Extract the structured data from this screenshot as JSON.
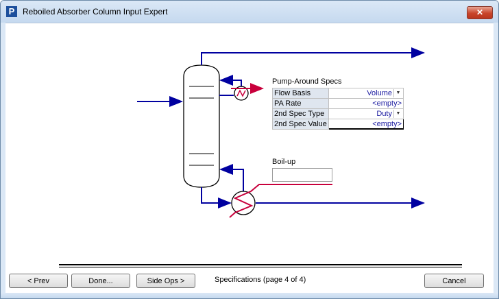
{
  "window": {
    "title": "Reboiled Absorber Column Input Expert",
    "icon_letter": "P",
    "close_glyph": "✕"
  },
  "pump_around": {
    "heading": "Pump-Around Specs",
    "rows": [
      {
        "key": "Flow Basis",
        "value": "Volume",
        "dropdown": true
      },
      {
        "key": "PA Rate",
        "value": "<empty>",
        "dropdown": false
      },
      {
        "key": "2nd Spec Type",
        "value": "Duty",
        "dropdown": true
      },
      {
        "key": "2nd Spec Value",
        "value": "<empty>",
        "dropdown": false
      }
    ]
  },
  "boilup": {
    "label": "Boil-up",
    "value": ""
  },
  "buttons": {
    "prev": "< Prev",
    "done": "Done...",
    "side_ops": "Side Ops >",
    "cancel": "Cancel"
  },
  "status": "Specifications (page 4 of 4)",
  "colors": {
    "stream": "#0000a0",
    "energy": "#c8003c",
    "titlebar": "#c5d9ef"
  }
}
